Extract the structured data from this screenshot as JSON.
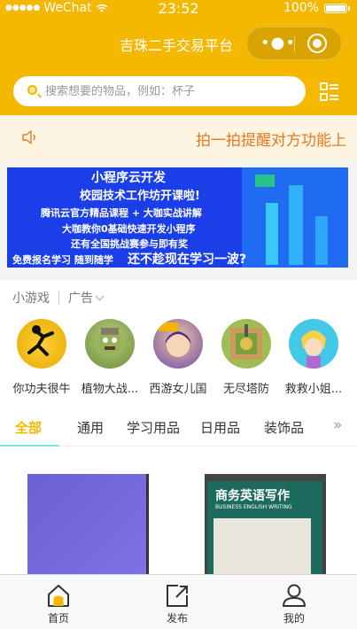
{
  "status_bar": {
    "carrier": "WeChat",
    "time": "23:52",
    "battery": "100%"
  },
  "navbar": {
    "title": "吉珠二手交易平台"
  },
  "search": {
    "placeholder": "搜索想要的物品，例如：杯子"
  },
  "notice": {
    "text": "拍一拍提醒对方功能上"
  },
  "banner": {
    "line1": "小程序云开发",
    "line2": "校园技术工作坊开课啦!",
    "line3": "腾讯云官方精品课程 + 大咖实战讲解",
    "line4": "大咖教你0基础快速开发小程序",
    "line5": "还有全国挑战赛参与即有奖",
    "line6": "免费报名学习 随到随学",
    "line7": "还不趁现在学习一波?"
  },
  "games": {
    "section_label": "小游戏",
    "ad_label": "广告",
    "items": [
      {
        "name": "你功夫很牛",
        "color": "#f6c400"
      },
      {
        "name": "植物大战...",
        "color": "#6c8c3a"
      },
      {
        "name": "西游女儿国",
        "color": "#6e4aa8"
      },
      {
        "name": "无尽塔防",
        "color": "#8fb24a"
      },
      {
        "name": "救救小姐...",
        "color": "#43c8e8"
      }
    ]
  },
  "tabs": {
    "items": [
      "全部",
      "通用",
      "学习用品",
      "日用品",
      "装饰品"
    ],
    "active_index": 0
  },
  "goods": {
    "item2_title": "商务英语写作",
    "item2_subtitle": "BUSINESS ENGLISH WRITING"
  },
  "tabbar": {
    "items": [
      {
        "label": "首页"
      },
      {
        "label": "发布"
      },
      {
        "label": "我的"
      }
    ]
  },
  "colors": {
    "brand": "#f5b800",
    "notice_text": "#e8781d",
    "active_tab": "#f5b800"
  }
}
